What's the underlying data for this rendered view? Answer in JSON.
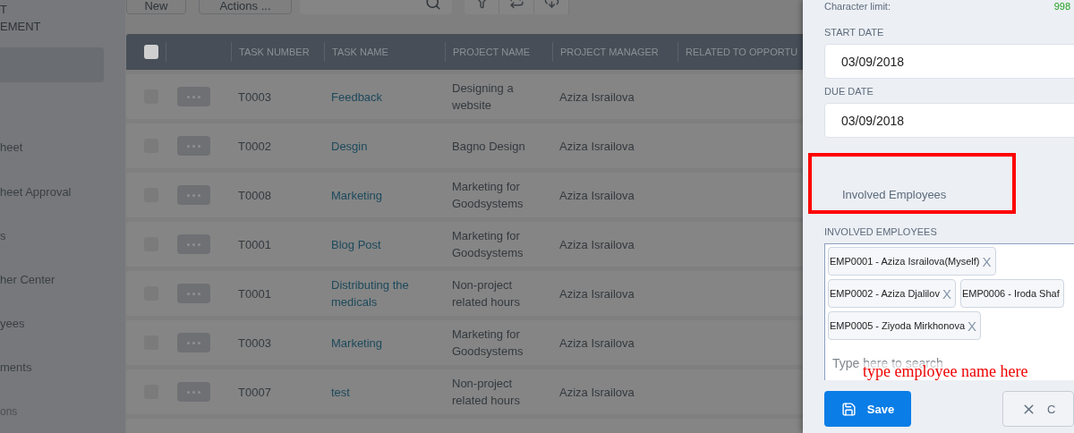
{
  "sidebar": {
    "title_lines": [
      "T",
      "EMENT"
    ],
    "items": [
      {
        "kind": "item",
        "selected": true
      },
      {
        "kind": "item",
        "label": "heet",
        "selected": false
      },
      {
        "kind": "item",
        "label": "heet Approval",
        "selected": false
      },
      {
        "kind": "item",
        "label": "s",
        "selected": false
      },
      {
        "kind": "item",
        "label": "her Center",
        "selected": false
      },
      {
        "kind": "item",
        "label": "yees",
        "selected": false
      },
      {
        "kind": "item",
        "label": "ments",
        "selected": false
      },
      {
        "kind": "section",
        "label": "ons",
        "selected": false
      }
    ]
  },
  "toolbar": {
    "buttons": [
      "New",
      "Actions ..."
    ]
  },
  "table": {
    "select_all_checked": false,
    "columns": [
      "TASK NUMBER",
      "TASK NAME",
      "PROJECT NAME",
      "PROJECT MANAGER",
      "RELATED TO OPPORTU"
    ],
    "rows": [
      {
        "checked": false,
        "task_number": "T0003",
        "task_name": "Feedback",
        "project_name": "Designing a website",
        "project_manager": "Aziza Israilova"
      },
      {
        "checked": false,
        "task_number": "T0002",
        "task_name": "Desgin",
        "project_name": "Bagno Design",
        "project_manager": "Aziza Israilova"
      },
      {
        "checked": false,
        "task_number": "T0008",
        "task_name": "Marketing",
        "project_name": "Marketing for Goodsystems",
        "project_manager": "Aziza Israilova"
      },
      {
        "checked": false,
        "task_number": "T0001",
        "task_name": "Blog Post",
        "project_name": "Marketing for Goodsystems",
        "project_manager": "Aziza Israilova"
      },
      {
        "checked": false,
        "task_number": "T0001",
        "task_name": "Distributing the medicals",
        "project_name": "Non-project related hours",
        "project_manager": "Aziza Israilova"
      },
      {
        "checked": false,
        "task_number": "T0003",
        "task_name": "Marketing",
        "project_name": "Marketing for Goodsystems",
        "project_manager": "Aziza Israilova"
      },
      {
        "checked": false,
        "task_number": "T0007",
        "task_name": "test",
        "project_name": "Non-project related hours",
        "project_manager": "Aziza Israilova"
      }
    ]
  },
  "panel": {
    "character_limit": {
      "label": "Character limit:",
      "value": "998"
    },
    "start_date": {
      "label": "START DATE",
      "value": "03/09/2018"
    },
    "due_date": {
      "label": "DUE DATE",
      "value": "03/09/2018"
    },
    "highlight_box": {
      "text": "Involved Employees"
    },
    "involved_employees": {
      "label": "INVOLVED EMPLOYEES",
      "tags": [
        {
          "label": "EMP0001 - Aziza Israilova(Myself)",
          "remove": "X"
        },
        {
          "label": "EMP0002 - Aziza Djalilov",
          "remove": "X"
        },
        {
          "label": "EMP0006 - Iroda Shaf"
        },
        {
          "label": "EMP0005 - Ziyoda Mirkhonova",
          "remove": "X"
        }
      ],
      "placeholder": "Type here to search"
    },
    "annotation": "type employee name here",
    "save_button": "Save",
    "cancel_button": "C"
  }
}
